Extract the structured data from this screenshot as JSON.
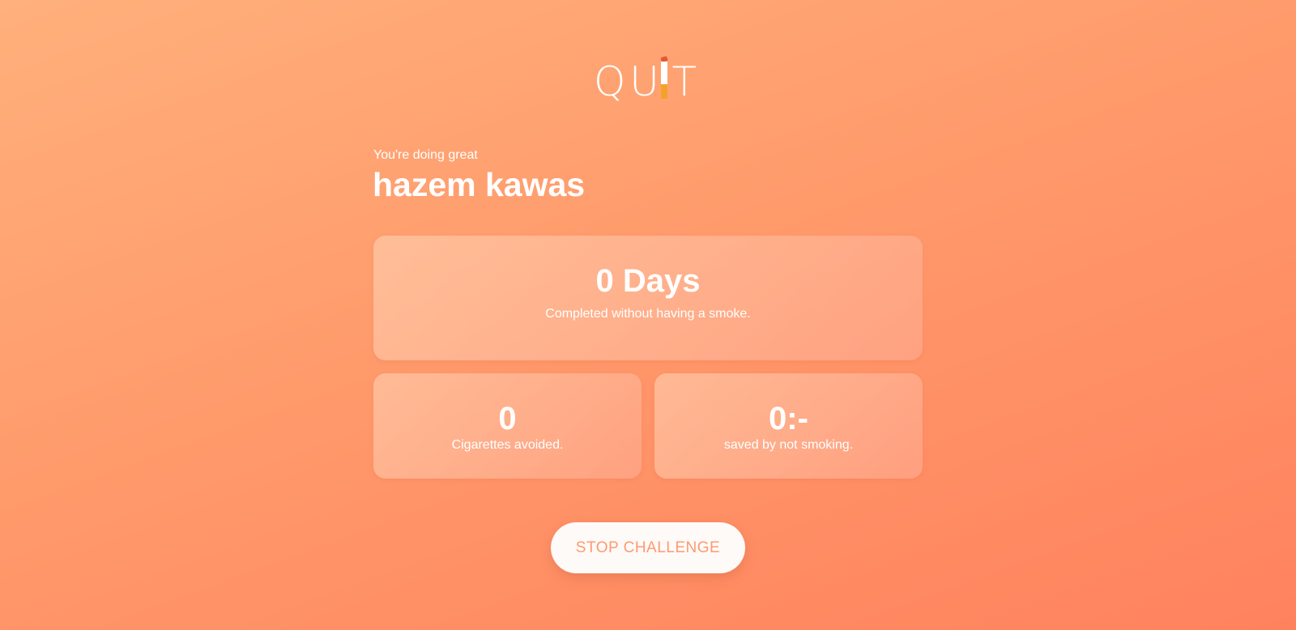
{
  "logo": {
    "letters": [
      "Q",
      "U",
      "T"
    ],
    "icon": "cigarette-icon",
    "alt": "QUIT"
  },
  "greeting": {
    "subtitle": "You're doing great",
    "name": "hazem kawas"
  },
  "stats": {
    "days": {
      "value": "0 Days",
      "label": "Completed without having a smoke."
    },
    "cigarettes": {
      "value": "0",
      "label": "Cigarettes avoided."
    },
    "money": {
      "value": "0:-",
      "label": "saved by not smoking."
    }
  },
  "actions": {
    "stop_label": "STOP CHALLENGE"
  },
  "colors": {
    "background_start": "#ffb07c",
    "background_end": "#ff825e",
    "button_text": "#ff9a6e",
    "cigarette_filter": "#f4a32a",
    "cigarette_ember": "#e25a34"
  }
}
